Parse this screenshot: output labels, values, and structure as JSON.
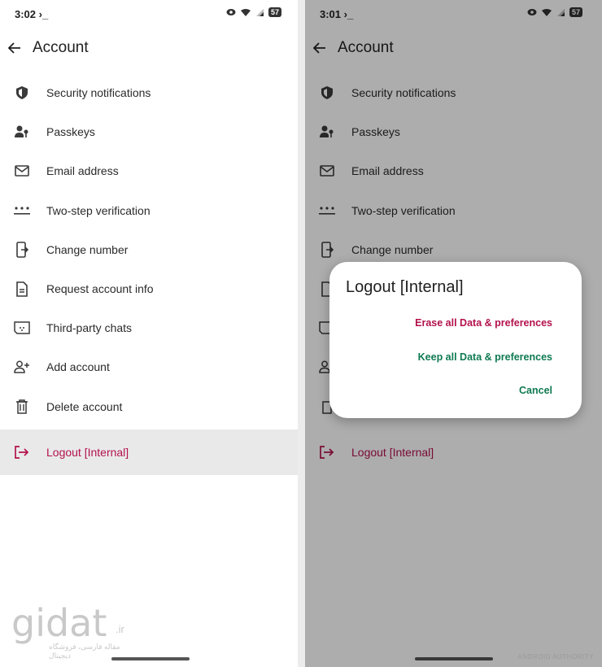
{
  "left": {
    "status": {
      "time": "3:02",
      "terminal": "›_",
      "battery": "57"
    },
    "title": "Account",
    "menu": [
      {
        "label": "Security notifications",
        "icon": "shield-icon"
      },
      {
        "label": "Passkeys",
        "icon": "passkey-icon"
      },
      {
        "label": "Email address",
        "icon": "mail-icon"
      },
      {
        "label": "Two-step verification",
        "icon": "pin-dots-icon"
      },
      {
        "label": "Change number",
        "icon": "phone-transfer-icon"
      },
      {
        "label": "Request account info",
        "icon": "document-icon"
      },
      {
        "label": "Third-party chats",
        "icon": "chat-icon"
      },
      {
        "label": "Add account",
        "icon": "add-person-icon"
      },
      {
        "label": "Delete account",
        "icon": "trash-icon"
      }
    ],
    "logout": "Logout [Internal]"
  },
  "right": {
    "status": {
      "time": "3:01",
      "terminal": "›_",
      "battery": "57"
    },
    "title": "Account",
    "menu": [
      {
        "label": "Security notifications"
      },
      {
        "label": "Passkeys"
      },
      {
        "label": "Email address"
      },
      {
        "label": "Two-step verification"
      },
      {
        "label": "Change number"
      }
    ],
    "logout": "Logout [Internal]",
    "dialog": {
      "title": "Logout [Internal]",
      "erase": "Erase all Data & preferences",
      "keep": "Keep all Data & preferences",
      "cancel": "Cancel"
    }
  },
  "watermark": {
    "logo": "gidat",
    "tld": ".ir",
    "subtitle": "مقاله فارسی، فروشگاه دیجیتال",
    "credit": "ANDROID AUTHORITY"
  },
  "colors": {
    "logout": "#b3124d",
    "accent_green": "#0f7a52",
    "scrim": "rgba(0,0,0,0.32)"
  }
}
